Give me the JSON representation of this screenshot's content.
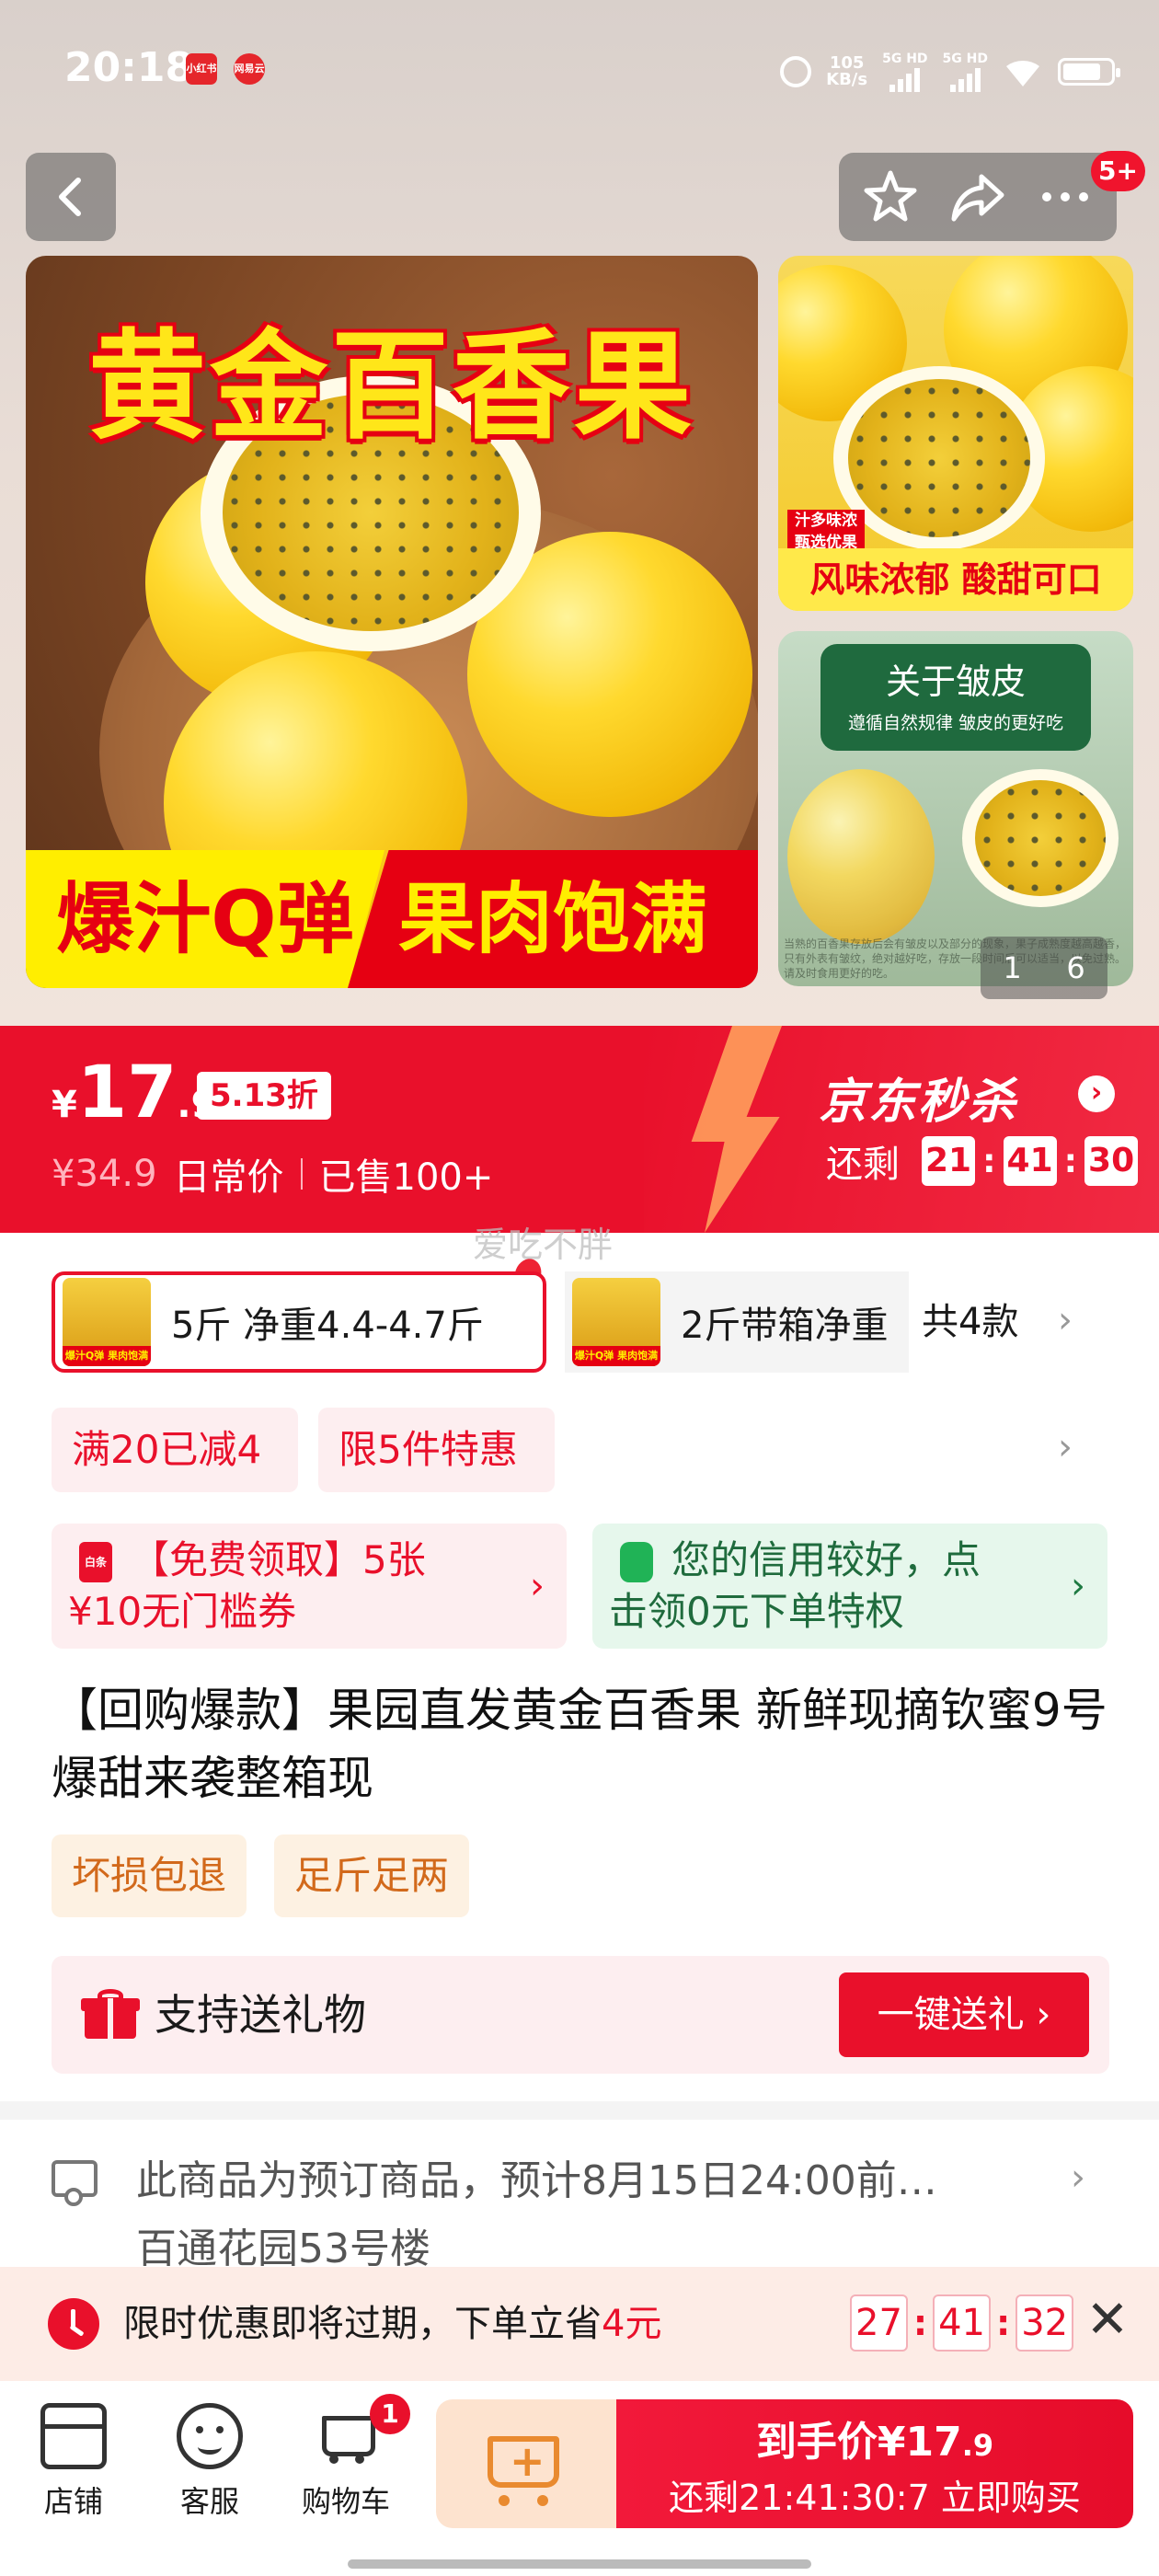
{
  "status_bar": {
    "time": "20:18",
    "app_icon_1": "小红书",
    "app_icon_2": "网易云",
    "speed_value": "105",
    "speed_unit": "KB/s",
    "signal_1": "5G HD",
    "signal_2": "5G HD",
    "battery_level": 0.8
  },
  "nav": {
    "back_icon": "chevron-left-icon",
    "favorite_icon": "star-outline-icon",
    "share_icon": "share-icon",
    "more_icon": "more-dots-icon",
    "badge": "5+"
  },
  "gallery": {
    "main_title": "黄金百香果",
    "banner_left": "爆汁Q弹",
    "banner_right": "果肉饱满",
    "thumb1_tag_1": "汁多味浓",
    "thumb1_tag_2": "甄选优果",
    "thumb1_caption": "风味浓郁 酸甜可口",
    "thumb2_title": "关于皱皮",
    "thumb2_subtitle": "遵循自然规律 皱皮的更好吃",
    "thumb2_fineprint": "当熟的百香果存放后会有皱皮以及部分的现象，果子成熟度越高越香，只有外表有皱纹，绝对越好吃，存放一段时间后可以适当，以免过熟。请及时食用更好的吃。",
    "pager_current": "1",
    "pager_total": "6"
  },
  "price": {
    "currency": "¥",
    "integer": "17",
    "decimal": ".9",
    "discount": "5.13折",
    "original": "¥34.9",
    "original_label": "日常价",
    "sold": "已售100+",
    "brand": "京东秒杀",
    "brand_arrow": "›",
    "countdown_label": "还剩",
    "countdown": [
      "21",
      "41",
      "30"
    ]
  },
  "watermark": "爱吃不胖",
  "specs": {
    "selected": "5斤 净重4.4-4.7斤",
    "alternate": "2斤带箱净重",
    "total": "共4款",
    "thumb_label": "爆汁Q弹 果肉饱满"
  },
  "promos": [
    "满20已减4",
    "限5件特惠"
  ],
  "coupons": {
    "red_icon": "白条",
    "red_line1": "【免费领取】5张",
    "red_line2": "¥10无门槛券",
    "green_line1": "您的信用较好，点",
    "green_line2": "击领0元下单特权"
  },
  "title": "【回购爆款】果园直发黄金百香果 新鲜现摘钦蜜9号爆甜来袭整箱现",
  "tags": [
    "坏损包退",
    "足斤足两"
  ],
  "gift": {
    "label": "支持送礼物",
    "button": "一键送礼 ›"
  },
  "delivery": {
    "line1": "此商品为预订商品，预计8月15日24:00前…",
    "line2": "百通花园53号楼"
  },
  "expire": {
    "text_prefix": "限时优惠即将过期，下单立省",
    "amount": "4元",
    "countdown": [
      "27",
      "41",
      "32"
    ],
    "close_icon": "close-icon"
  },
  "bottom": {
    "store": "店铺",
    "service": "客服",
    "cart": "购物车",
    "cart_count": "1",
    "buy_prefix": "到手价",
    "buy_price": "¥17",
    "buy_decimal": ".9",
    "buy_countdown": "还剩21:41:30:7  立即购买"
  },
  "colors": {
    "accent_red": "#e9102b",
    "green": "#1e7a42",
    "orange": "#d2691b"
  }
}
